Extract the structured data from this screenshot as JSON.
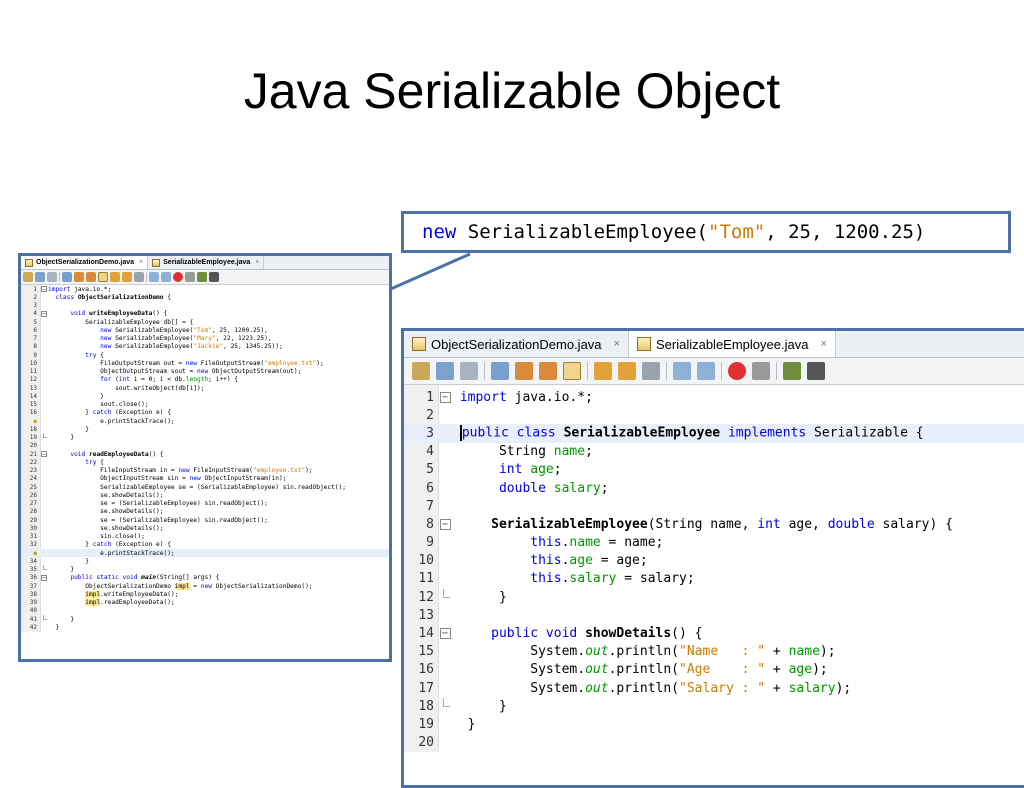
{
  "slide": {
    "title": "Java Serializable Object"
  },
  "callout": {
    "kw": "new",
    "cls": " SerializableEmployee(",
    "arg1": "\"Tom\"",
    "rest": ", 25, 1200.25)"
  },
  "tabs": [
    {
      "label": "ObjectSerializationDemo.java",
      "close": "×"
    },
    {
      "label": "SerializableEmployee.java",
      "close": "×"
    }
  ],
  "colors": {
    "frame": "#4a72a8",
    "keyword": "#0000e6",
    "string": "#ce7b00",
    "field": "#009900"
  },
  "small_editor": {
    "lines": [
      "1",
      "2",
      "3",
      "4",
      "5",
      "6",
      "7",
      "8",
      "9",
      "10",
      "11",
      "12",
      "13",
      "14",
      "15",
      "16",
      "17",
      "18",
      "19",
      "20",
      "21",
      "22",
      "23",
      "24",
      "25",
      "26",
      "27",
      "28",
      "29",
      "30",
      "31",
      "32",
      "33",
      "34",
      "35",
      "36",
      "37",
      "38",
      "39",
      "40",
      "41",
      "42"
    ],
    "code": {
      "l1_kw": "import",
      "l1": " java.io.*;",
      "l2_kw": "class",
      "l2_b": "ObjectSerializationDemo",
      "l2": " {",
      "l4_kw": "void",
      "l4_b": "writeEmployeeData",
      "l4": "() {",
      "l5": "SerializableEmployee db[] = {",
      "l6_kw": "new",
      "l6a": " SerializableEmployee(",
      "l6s": "\"Tom\"",
      "l6b": ", 25, 1200.25),",
      "l7_kw": "new",
      "l7a": " SerializableEmployee(",
      "l7s": "\"Mary\"",
      "l7b": ", 22, 1223.25),",
      "l8_kw": "new",
      "l8a": " SerializableEmployee(",
      "l8s": "\"Jackie\"",
      "l8b": ", 25, 1345.25));",
      "l9_kw": "try",
      "l9": " {",
      "l10a": "FileOutputStream out = ",
      "l10_kw": "new",
      "l10b": " FileOutputStream(",
      "l10s": "\"employee.txt\"",
      "l10c": ");",
      "l11a": "ObjectOutputStream sout = ",
      "l11_kw": "new",
      "l11b": " ObjectOutputStream(out);",
      "l12_kw": "for",
      "l12a": " (",
      "l12_kw2": "int",
      "l12b": " i = 0; i < db.",
      "l12f": "length",
      "l12c": "; i++) {",
      "l13": "sout.writeObject(db[i]);",
      "l14": "}",
      "l15": "sout.close();",
      "l16a": "} ",
      "l16_kw": "catch",
      "l16b": " (Exception e) {",
      "l17": "e.printStackTrace();",
      "l18": "}",
      "l19": "}",
      "l21_kw": "void",
      "l21_b": "readEmployeeData",
      "l21": "() {",
      "l22_kw": "try",
      "l22": " {",
      "l23a": "FileInputStream in = ",
      "l23_kw": "new",
      "l23b": " FileInputStream(",
      "l23s": "\"employee.txt\"",
      "l23c": ");",
      "l24a": "ObjectInputStream sin = ",
      "l24_kw": "new",
      "l24b": " ObjectInputStream(in);",
      "l25": "SerializableEmployee se = (SerializableEmployee) sin.readObject();",
      "l26": "se.showDetails();",
      "l27": "se = (SerializableEmployee) sin.readObject();",
      "l28": "se.showDetails();",
      "l29": "se = (SerializableEmployee) sin.readObject();",
      "l30": "se.showDetails();",
      "l31": "sin.close();",
      "l32a": "} ",
      "l32_kw": "catch",
      "l32b": " (Exception e) {",
      "l33": "e.printStackTrace();",
      "l34": "}",
      "l35": "}",
      "l36_kw": "public static void",
      "l36_b": "main",
      "l36": "(String[] args) {",
      "l37a": "ObjectSerializationDemo ",
      "l37m": "impl",
      "l37b": " = ",
      "l37_kw": "new",
      "l37c": " ObjectSerializationDemo();",
      "l38m": "impl",
      "l38": ".writeEmployeeData();",
      "l39m": "impl",
      "l39": ".readEmployeeData();",
      "l41": "}",
      "l42": "}"
    }
  },
  "large_editor": {
    "lines": [
      "1",
      "2",
      "3",
      "4",
      "5",
      "6",
      "7",
      "8",
      "9",
      "10",
      "11",
      "12",
      "13",
      "14",
      "15",
      "16",
      "17",
      "18",
      "19",
      "20"
    ],
    "code": {
      "l1_kw": "import",
      "l1": " java.io.*;",
      "l3_kw": "public class",
      "l3_b": "SerializableEmployee",
      "l3_kw2": "implements",
      "l3": " Serializable {",
      "l4": "String ",
      "l4_f": "name",
      "l4e": ";",
      "l5_kw": "int",
      "l5_f": "age",
      "l5e": ";",
      "l6_kw": "double",
      "l6_f": "salary",
      "l6e": ";",
      "l8_b": "SerializableEmployee",
      "l8a": "(String name, ",
      "l8_kw": "int",
      "l8b": " age, ",
      "l8_kw2": "double",
      "l8c": " salary) {",
      "l9_kw": "this",
      "l9a": ".",
      "l9_f": "name",
      "l9b": " = name;",
      "l10_kw": "this",
      "l10a": ".",
      "l10_f": "age",
      "l10b": " = age;",
      "l11_kw": "this",
      "l11a": ".",
      "l11_f": "salary",
      "l11b": " = salary;",
      "l12": "}",
      "l14_kw": "public void",
      "l14_b": "showDetails",
      "l14": "() {",
      "l15a": "System.",
      "l15_i": "out",
      "l15b": ".println(",
      "l15s": "\"Name   : \"",
      "l15c": " + ",
      "l15_f": "name",
      "l15d": ");",
      "l16a": "System.",
      "l16_i": "out",
      "l16b": ".println(",
      "l16s": "\"Age    : \"",
      "l16c": " + ",
      "l16_f": "age",
      "l16d": ");",
      "l17a": "System.",
      "l17_i": "out",
      "l17b": ".println(",
      "l17s": "\"Salary : \"",
      "l17c": " + ",
      "l17_f": "salary",
      "l17d": ");",
      "l18": "}",
      "l19": "}"
    }
  }
}
